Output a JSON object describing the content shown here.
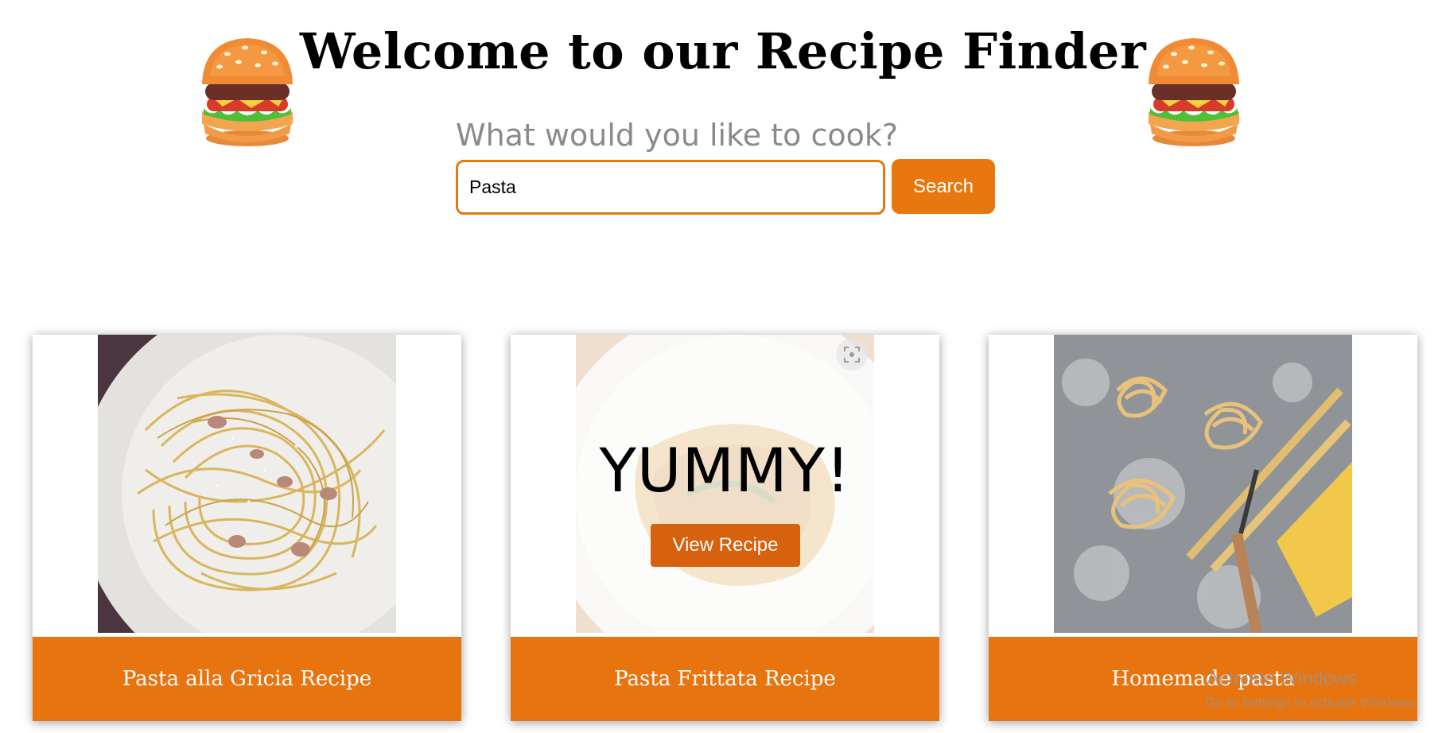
{
  "header": {
    "title": "Welcome to our Recipe Finder",
    "decoration_icon": "burger-icon"
  },
  "search": {
    "prompt": "What would you like to cook?",
    "value": "Pasta",
    "button_label": "Search"
  },
  "recipes": [
    {
      "title": "Pasta alla Gricia Recipe",
      "image": "spaghetti-plate"
    },
    {
      "title": "Pasta Frittata Recipe",
      "image": "frittata-plate",
      "hover_text": "YUMMY!",
      "hover_button": "View Recipe"
    },
    {
      "title": "Homemade pasta",
      "image": "fresh-tagliatelle-nests"
    }
  ],
  "system": {
    "activation_title": "Activate Windows",
    "activation_subtitle": "Go to Settings to activate Windows."
  },
  "colors": {
    "accent": "#e8770f",
    "accent_dark": "#d6620f",
    "prompt_gray": "#8a8a8a"
  }
}
